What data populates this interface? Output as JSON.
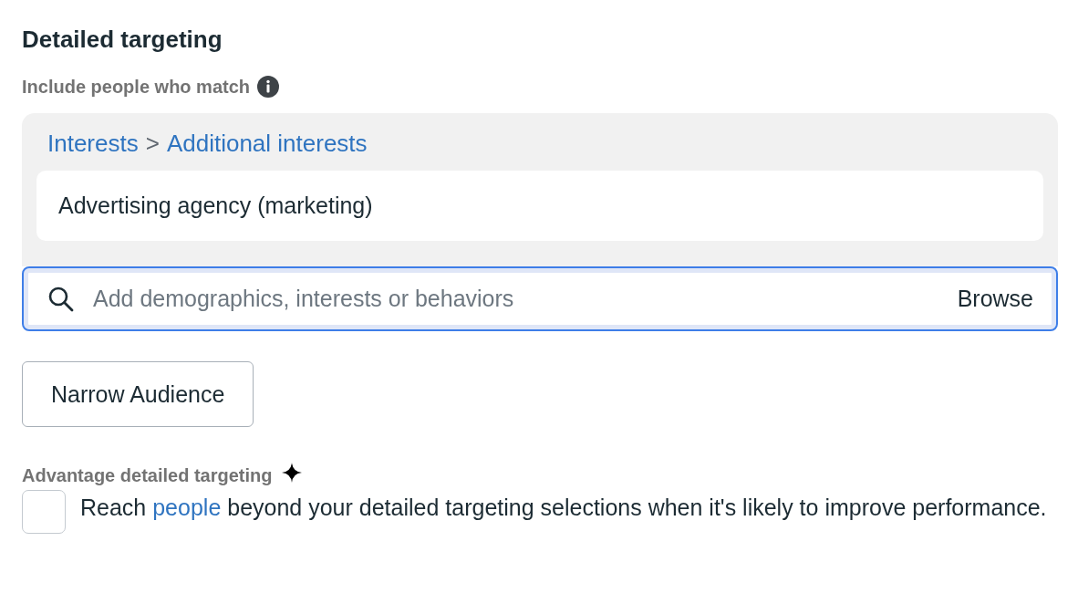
{
  "section": {
    "title": "Detailed targeting",
    "subtitle": "Include people who match"
  },
  "targeting": {
    "breadcrumb": [
      "Interests",
      "Additional interests"
    ],
    "separator": ">",
    "items": [
      "Advertising agency (marketing)"
    ]
  },
  "search": {
    "placeholder": "Add demographics, interests or behaviors",
    "browse": "Browse",
    "focused": true
  },
  "narrow_button": "Narrow Audience",
  "advantage": {
    "label": "Advantage detailed targeting",
    "checked": false,
    "text_before": "Reach ",
    "link": "people",
    "text_after": " beyond your detailed targeting selections when it's likely to improve performance."
  }
}
